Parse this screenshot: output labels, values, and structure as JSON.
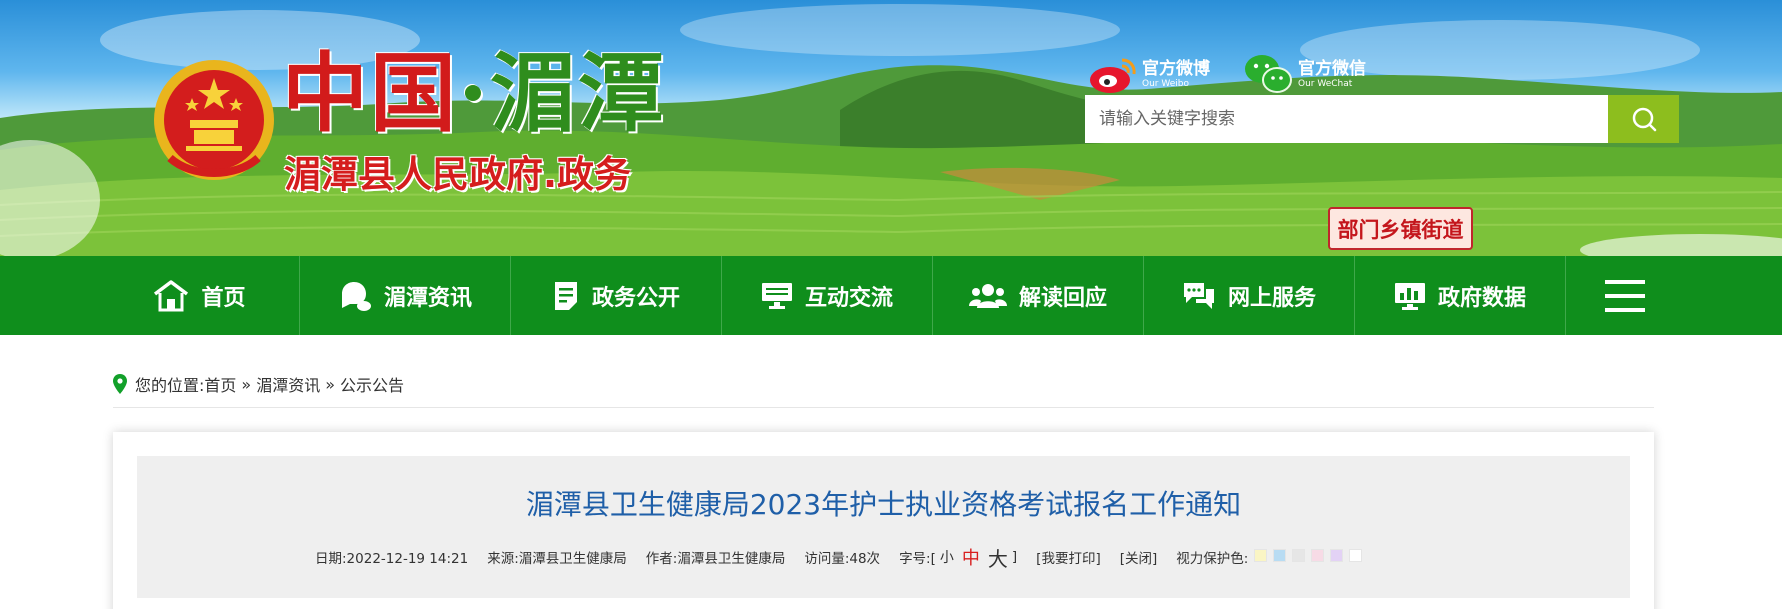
{
  "header": {
    "logo_part1": "中国",
    "logo_dot": "·",
    "logo_part2": "湄潭",
    "subtitle": "湄潭县人民政府.政务",
    "weibo_label": "官方微博",
    "weibo_en": "Our Weibo",
    "wechat_label": "官方微信",
    "wechat_en": "Our WeChat",
    "search_placeholder": "请输入关键字搜索",
    "dept_button": "部门乡镇街道"
  },
  "nav": {
    "items": [
      {
        "label": "首页",
        "icon": "home-icon"
      },
      {
        "label": "湄潭资讯",
        "icon": "news-icon"
      },
      {
        "label": "政务公开",
        "icon": "document-icon"
      },
      {
        "label": "互动交流",
        "icon": "monitor-icon"
      },
      {
        "label": "解读回应",
        "icon": "people-icon"
      },
      {
        "label": "网上服务",
        "icon": "chat-icon"
      },
      {
        "label": "政府数据",
        "icon": "chart-icon"
      }
    ],
    "menu_icon": "hamburger-icon"
  },
  "breadcrumb": {
    "prefix": "您的位置:",
    "home": "首页",
    "sep": "»",
    "section": "湄潭资讯",
    "current": "公示公告"
  },
  "article": {
    "title": "湄潭县卫生健康局2023年护士执业资格考试报名工作通知",
    "date": "日期:2022-12-19 14:21",
    "source": "来源:湄潭县卫生健康局",
    "author": "作者:湄潭县卫生健康局",
    "views": "访问量:48次",
    "font_label": "字号:[",
    "font_small": "小",
    "font_mid": "中",
    "font_big": "大",
    "font_close": "]",
    "print": "[我要打印]",
    "close": "[关闭]",
    "eye_label": "视力保护色:",
    "eye_colors": [
      "#faf5c4",
      "#b8dcf3",
      "#e6e6e6",
      "#f7dbe6",
      "#e3d2f5",
      "#ffffff"
    ]
  },
  "colors": {
    "nav_green": "#0f8e1c",
    "search_green": "#8dbe1e",
    "title_blue": "#1f5fa8"
  }
}
